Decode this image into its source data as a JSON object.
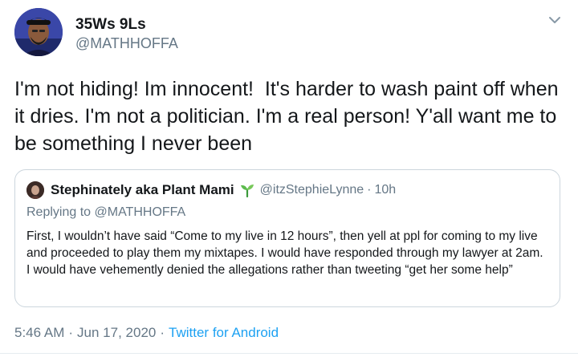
{
  "author": {
    "display_name": "35Ws 9Ls",
    "handle": "@MATHHOFFA",
    "avatar_icon": "profile-photo"
  },
  "menu_icon": "chevron-down-icon",
  "tweet": {
    "text": "I'm not hiding! Im innocent!  It's harder to wash paint off when it dries. I'm not a politician. I'm a real person! Y'all want me to be something I never been"
  },
  "quoted_tweet": {
    "display_name": "Stephinately aka Plant Mami",
    "badge_icon": "sprout-emoji",
    "handle": "@itzStephieLynne",
    "separator": "·",
    "time": "10h",
    "replying_to_prefix": "Replying to",
    "replying_to_handle": "@MATHHOFFA",
    "text": "First, I wouldn’t have said “Come to my live in 12 hours”, then yell at ppl for coming to my live and proceeded to play them my mixtapes.  I would have responded through my lawyer at 2am. I would have vehemently denied the allegations rather than tweeting “get her some help”"
  },
  "meta": {
    "time": "5:46 AM",
    "separator": "·",
    "date": "Jun 17, 2020",
    "source": "Twitter for Android"
  },
  "colors": {
    "text": "#14171a",
    "secondary": "#657786",
    "link": "#1da1f2",
    "border": "#ccd6dd"
  }
}
